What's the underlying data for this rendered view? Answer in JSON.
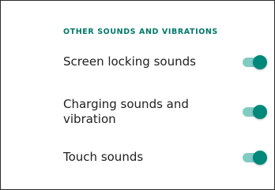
{
  "section": {
    "header": "OTHER SOUNDS AND VIBRATIONS"
  },
  "settings": [
    {
      "label": "Screen locking sounds",
      "enabled": true
    },
    {
      "label": "Charging sounds and vibration",
      "enabled": true
    },
    {
      "label": "Touch sounds",
      "enabled": true
    }
  ],
  "colors": {
    "accent": "#00897b",
    "accent_track": "#80cbc4",
    "header": "#00796b",
    "text": "#212121"
  }
}
